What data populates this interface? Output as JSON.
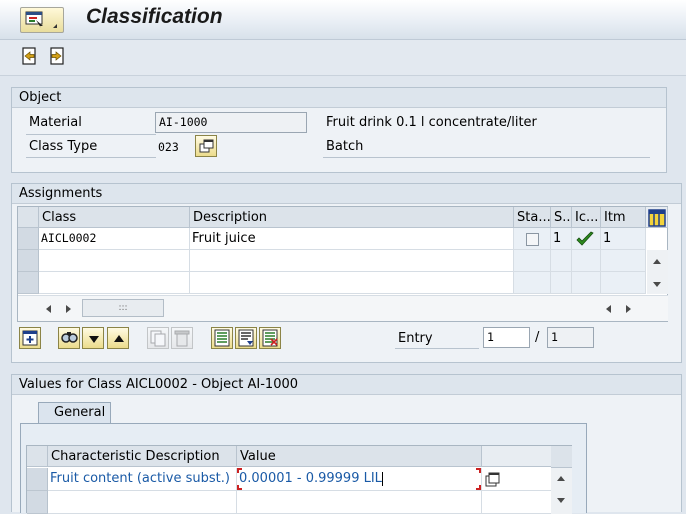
{
  "app": {
    "title": "Classification"
  },
  "object_panel": {
    "heading": "Object",
    "material_label": "Material",
    "material_value": "AI-1000",
    "material_description": "Fruit drink 0.1 l concentrate/liter",
    "class_type_label": "Class Type",
    "class_type_value": "023",
    "class_type_description": "Batch"
  },
  "assignments": {
    "heading": "Assignments",
    "columns": [
      "Class",
      "Description",
      "Sta...",
      "S..",
      "Ic...",
      "Itm"
    ],
    "rows": [
      {
        "class": "AICL0002",
        "description": "Fruit juice",
        "status_checked": false,
        "s": "1",
        "icon": "green-check-icon",
        "item": "1"
      }
    ],
    "entry_label": "Entry",
    "entry_value": "1",
    "entry_separator": "/",
    "entry_total": "1",
    "hscroll_grip": ":::"
  },
  "values": {
    "heading": "Values for Class AICL0002 - Object AI-1000",
    "tab_general": "General",
    "columns": [
      "Characteristic Description",
      "Value"
    ],
    "rows": [
      {
        "characteristic": "Fruit content (active subst.)",
        "value": "0.00001 - 0.99999 LIL"
      }
    ]
  },
  "colors": {
    "link_blue": "#1a5aa6",
    "check_green": "#2e8b1f",
    "error_red": "#cc2222"
  }
}
